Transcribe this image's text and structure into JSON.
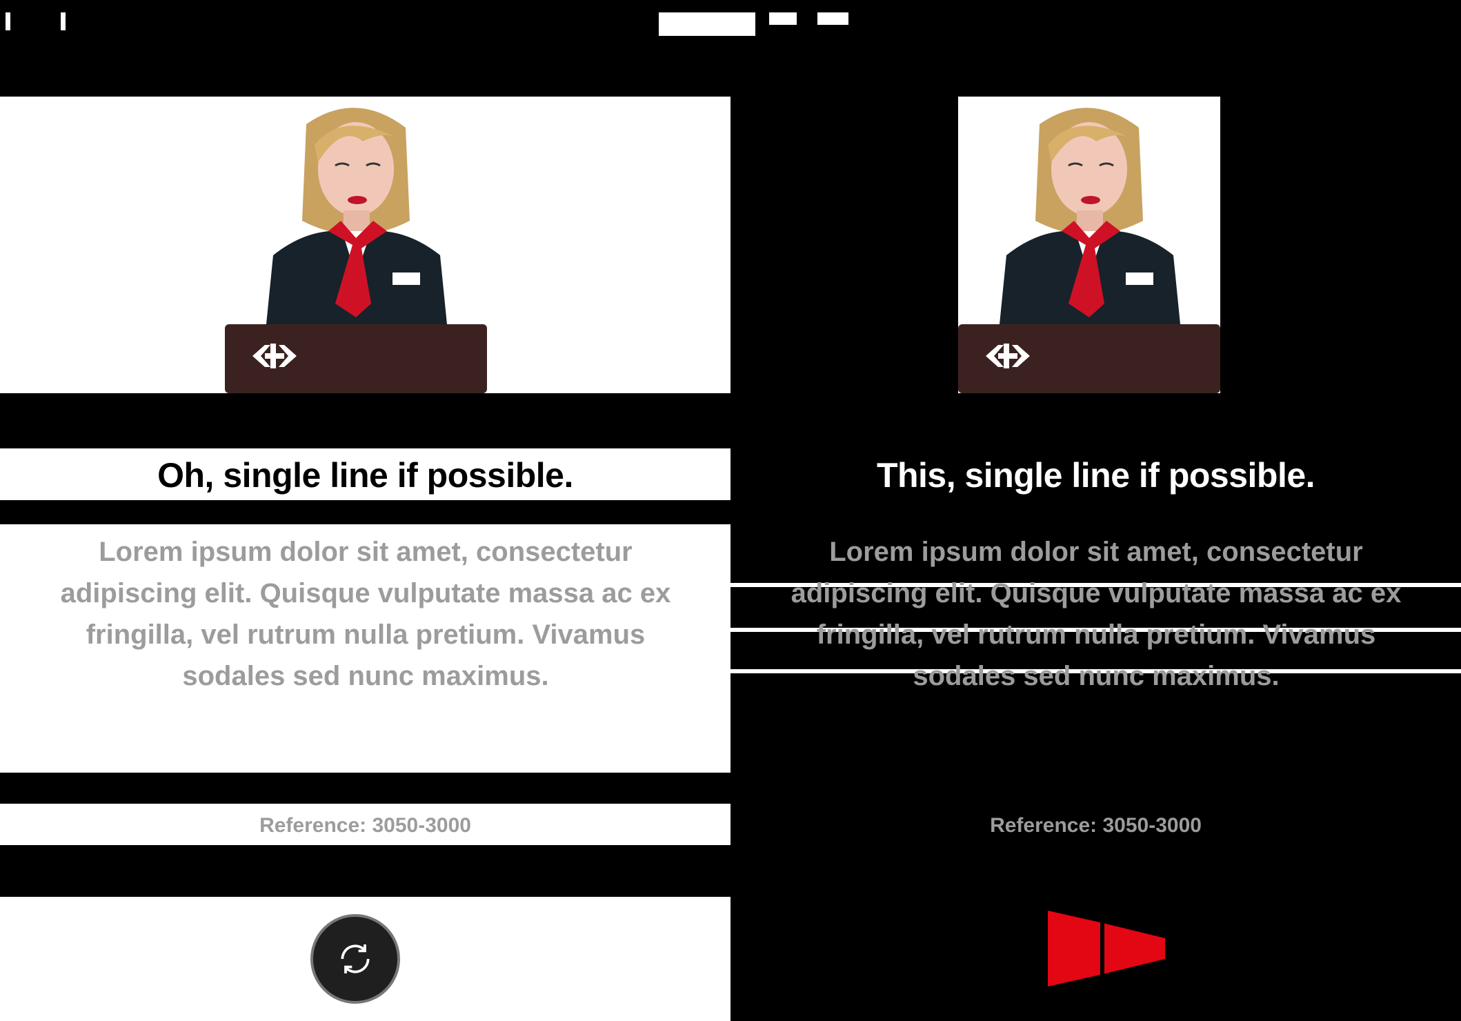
{
  "colors": {
    "background": "#000000",
    "panel": "#ffffff",
    "accent_red": "#e30613",
    "text_muted": "#9c9c9c",
    "desk": "#3b2220",
    "button_bg": "#1f1f1f"
  },
  "cards": [
    {
      "heading": "Oh, single line if possible.",
      "body": "Lorem ipsum dolor sit amet, consectetur adipiscing elit. Quisque vulputate massa ac ex fringilla, vel rutrum nulla pretium. Vivamus sodales sed nunc maximus.",
      "caption": "Reference: 3050-3000",
      "action_icon": "refresh-icon"
    },
    {
      "heading": "This, single line if possible.",
      "body": "Lorem ipsum dolor sit amet, consectetur adipiscing elit. Quisque vulputate massa ac ex fringilla, vel rutrum nulla pretium. Vivamus sodales sed nunc maximus.",
      "caption": "Reference: 3050-3000",
      "action_icon": "sbb-flag-icon"
    }
  ]
}
